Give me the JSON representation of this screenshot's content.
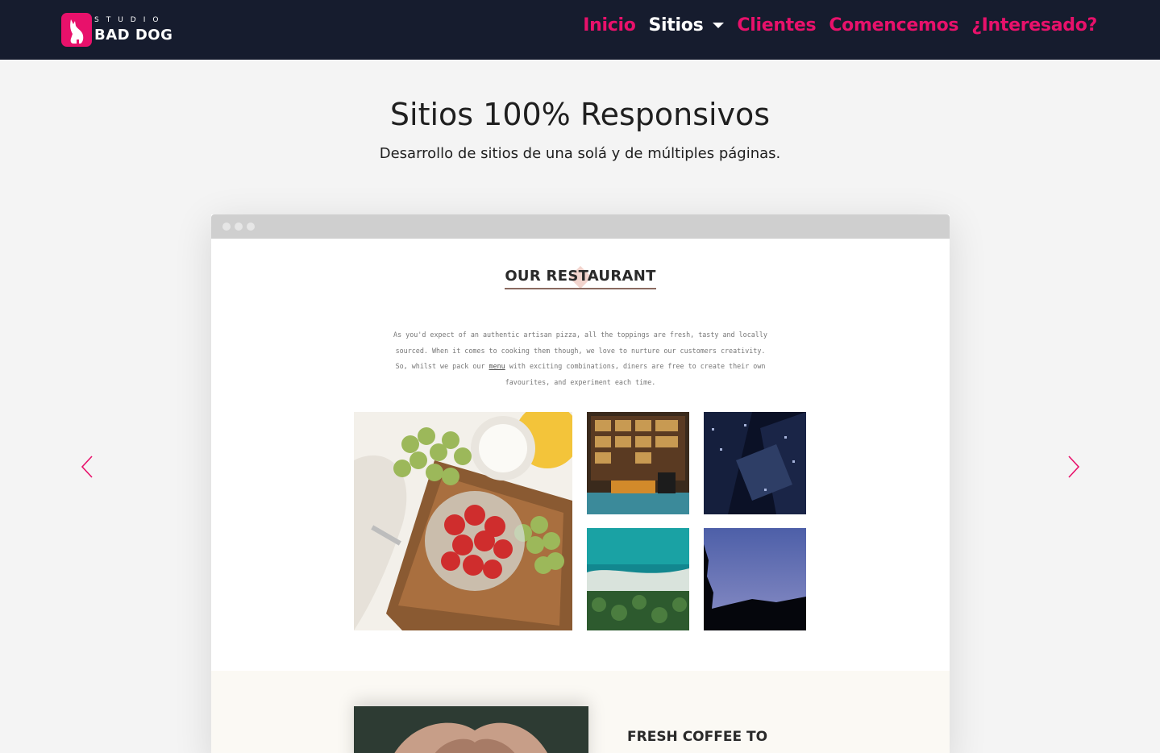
{
  "brand": {
    "small_text": "STUDIO",
    "name": "BAD DOG",
    "accent_color": "#e8116b"
  },
  "nav": {
    "items": [
      {
        "label": "Inicio"
      },
      {
        "label": "Sitios"
      },
      {
        "label": "Clientes"
      },
      {
        "label": "Comencemos"
      },
      {
        "label": "¿Interesado?"
      }
    ],
    "active": "Sitios"
  },
  "hero": {
    "title": "Sitios 100% Responsivos",
    "subtitle": "Desarrollo de sitios de una solá y de múltiples páginas."
  },
  "carousel": {
    "prev_icon": "chevron-left-icon",
    "next_icon": "chevron-right-icon"
  },
  "slide": {
    "site_title": "OUR RESTAURANT",
    "text_before_link": "As you'd expect of an authentic artisan pizza, all the toppings are fresh, tasty and locally sourced. When it comes to cooking them though, we love to nurture our customers creativity. So, whilst we pack our",
    "link": "menu",
    "text_after_link": "with exciting combinations, diners are free to create their own favourites, and experiment each time.",
    "section2_title": "FRESH COFFEE TO"
  }
}
